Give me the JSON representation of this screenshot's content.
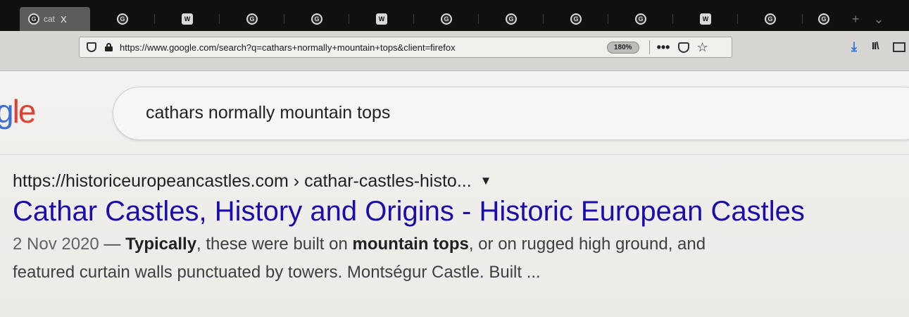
{
  "tabs": [
    {
      "icon": "G",
      "type": "google",
      "label": "cat",
      "active": true
    },
    {
      "icon": "G",
      "type": "google"
    },
    {
      "icon": "W",
      "type": "wiki"
    },
    {
      "icon": "G",
      "type": "google"
    },
    {
      "icon": "G",
      "type": "google"
    },
    {
      "icon": "W",
      "type": "wiki"
    },
    {
      "icon": "G",
      "type": "google"
    },
    {
      "icon": "G",
      "type": "google"
    },
    {
      "icon": "G",
      "type": "google"
    },
    {
      "icon": "G",
      "type": "google"
    },
    {
      "icon": "W",
      "type": "wiki"
    },
    {
      "icon": "G",
      "type": "google"
    },
    {
      "icon": "G",
      "type": "google"
    }
  ],
  "tabbar": {
    "close_glyph": "X",
    "new_tab_glyph": "+",
    "menu_glyph": "⌄"
  },
  "urlbar": {
    "url": "https://www.google.com/search?q=cathars+normally+mountain+tops&client=firefox",
    "zoom": "180%",
    "actions_glyph": "•••",
    "star_glyph": "☆"
  },
  "toolbar": {
    "downloads_glyph": "⤓",
    "library_glyph": "II\\"
  },
  "google": {
    "logo_blue": "g",
    "logo_red": "le",
    "query": "cathars normally mountain tops"
  },
  "result": {
    "cite": "https://historiceuropeancastles.com › cathar-castles-histo...",
    "cite_arrow": "▼",
    "title": "Cathar Castles, History and Origins - Historic European Castles",
    "date": "2 Nov 2020",
    "dash": " — ",
    "s1_bold": "Typically",
    "s1": ", these were built on ",
    "s2_bold": "mountain tops",
    "s2": ", or on rugged high ground, and",
    "line2": "featured curtain walls punctuated by towers. Montségur Castle. Built ..."
  },
  "colors": {
    "link": "#1a0dab",
    "tabstrip": "#101010",
    "download_accent": "#2a70d8"
  }
}
